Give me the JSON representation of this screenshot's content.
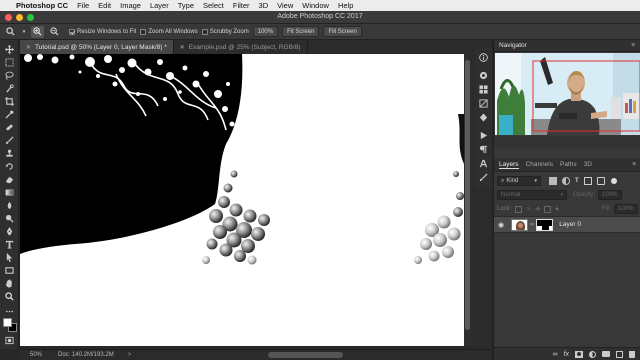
{
  "menubar": {
    "apple_glyph": "",
    "app_name": "Photoshop CC",
    "items": [
      "File",
      "Edit",
      "Image",
      "Layer",
      "Type",
      "Select",
      "Filter",
      "3D",
      "View",
      "Window",
      "Help"
    ]
  },
  "window": {
    "title": "Adobe Photoshop CC 2017"
  },
  "options_bar": {
    "resize_windows_label": "Resize Windows to Fit",
    "resize_windows_checked": true,
    "zoom_all_label": "Zoom All Windows",
    "zoom_all_checked": false,
    "scrubby_label": "Scrubby Zoom",
    "scrubby_checked": false,
    "btn_100": "100%",
    "btn_fit": "Fit Screen",
    "btn_fill": "Fill Screen"
  },
  "document_tabs": [
    {
      "label": "Tutorial.psd @ 50% (Layer 0, Layer Mask/8) *",
      "active": true
    },
    {
      "label": "Example.psd @ 25% (Subject, RGB/8)",
      "active": false
    }
  ],
  "status_bar": {
    "zoom": "50%",
    "doc_info": "Doc: 140.2M/193.2M",
    "arrow": ">"
  },
  "navigator": {
    "title": "Navigator",
    "menu_glyph": "≡"
  },
  "layers_panel": {
    "tabs": [
      "Layers",
      "Channels",
      "Paths",
      "3D"
    ],
    "active_tab": "Layers",
    "kind_label": "Kind",
    "blend_mode": "Normal",
    "opacity_label": "Opacity:",
    "opacity_value": "100%",
    "lock_label": "Lock:",
    "fill_label": "Fill:",
    "fill_value": "100%",
    "layers": [
      {
        "name": "Layer 0",
        "visible": true
      }
    ],
    "footer_icons": [
      "link-icon",
      "fx-icon",
      "mask-icon",
      "adjustment-icon",
      "folder-icon",
      "new-layer-icon",
      "trash-icon"
    ]
  },
  "colors": {
    "accent_close": "#ff5f57",
    "accent_minimize": "#febc2e",
    "accent_zoom": "#28c840",
    "panel_bg": "#383838",
    "canvas_bg": "#ffffff"
  }
}
